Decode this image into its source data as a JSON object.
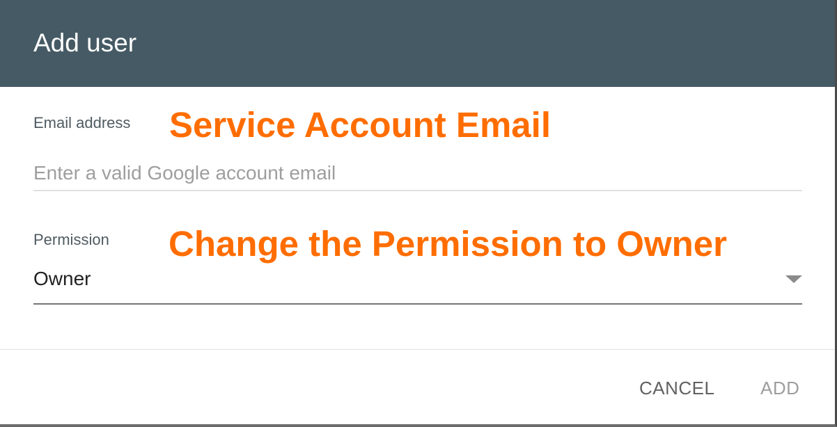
{
  "dialog": {
    "title": "Add user"
  },
  "email_field": {
    "label": "Email address",
    "placeholder": "Enter a valid Google account email",
    "value": ""
  },
  "permission_field": {
    "label": "Permission",
    "selected": "Owner",
    "dropdown_icon": "arrow-drop-down-icon"
  },
  "annotations": {
    "email_note": "Service Account Email",
    "permission_note": "Change the Permission to Owner",
    "color": "#ff6d00"
  },
  "actions": {
    "cancel_label": "CANCEL",
    "add_label": "ADD"
  },
  "colors": {
    "header_bg": "#455a64",
    "header_text": "#ffffff"
  }
}
